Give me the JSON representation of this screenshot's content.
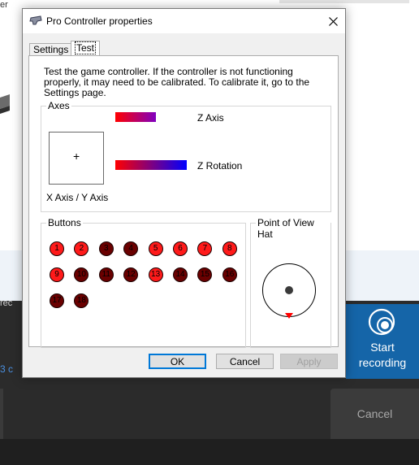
{
  "background": {
    "fragment_top": "er",
    "fragment_rec": "rec",
    "fragment_link": "3 c",
    "start_recording_label": "Start recording",
    "cancel_label": "Cancel"
  },
  "dialog": {
    "title": "Pro Controller properties",
    "tabs": [
      "Settings",
      "Test"
    ],
    "active_tab": "Test",
    "intro": "Test the game controller.  If the controller is not functioning properly, it may need to be calibrated.  To calibrate it, go to the Settings page.",
    "axes": {
      "group_label": "Axes",
      "xy_label": "X Axis / Y Axis",
      "z_label": "Z Axis",
      "z_rotation_label": "Z Rotation"
    },
    "buttons": {
      "group_label": "Buttons",
      "items": [
        {
          "label": "1",
          "pressed": true
        },
        {
          "label": "2",
          "pressed": true
        },
        {
          "label": "3",
          "pressed": false
        },
        {
          "label": "4",
          "pressed": false
        },
        {
          "label": "5",
          "pressed": true
        },
        {
          "label": "6",
          "pressed": true
        },
        {
          "label": "7",
          "pressed": true
        },
        {
          "label": "8",
          "pressed": true
        },
        {
          "label": "9",
          "pressed": true
        },
        {
          "label": "10",
          "pressed": false
        },
        {
          "label": "11",
          "pressed": false
        },
        {
          "label": "12",
          "pressed": false
        },
        {
          "label": "13",
          "pressed": true
        },
        {
          "label": "14",
          "pressed": false
        },
        {
          "label": "15",
          "pressed": false
        },
        {
          "label": "16",
          "pressed": false
        },
        {
          "label": "17",
          "pressed": false
        },
        {
          "label": "18",
          "pressed": false
        }
      ]
    },
    "pov": {
      "group_label": "Point of View Hat"
    },
    "ok_label": "OK",
    "cancel_label": "Cancel",
    "apply_label": "Apply"
  },
  "colors": {
    "accent": "#0078d7",
    "button_on": "#ff1a1a",
    "button_off": "#6a0000",
    "record_tile": "#1565a8"
  }
}
